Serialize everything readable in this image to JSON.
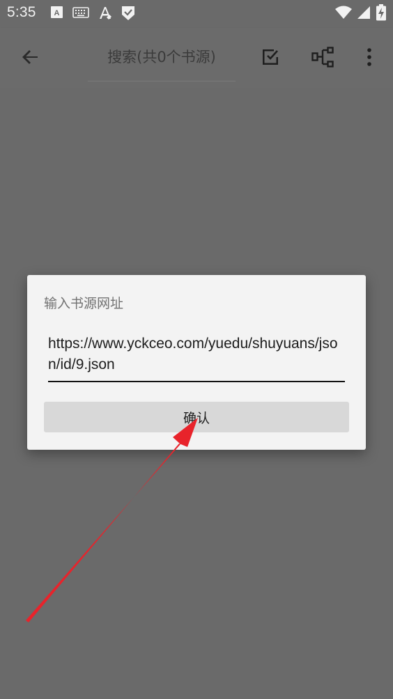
{
  "status_bar": {
    "time": "5:35",
    "icons": [
      "a-text-icon",
      "keyboard-icon",
      "font-icon",
      "shield-check-icon",
      "wifi-icon",
      "signal-icon",
      "battery-charging-icon"
    ]
  },
  "app_bar": {
    "back_icon": "back-arrow-icon",
    "search_placeholder": "搜索(共0个书源)",
    "actions": [
      "select-all-icon",
      "group-icon",
      "more-vert-icon"
    ]
  },
  "dialog": {
    "title": "输入书源网址",
    "url_value": "https://www.yckceo.com/yuedu/shuyuans/json/id/9.json",
    "confirm_label": "确认"
  },
  "annotation": {
    "arrow_color": "#e8232b"
  }
}
